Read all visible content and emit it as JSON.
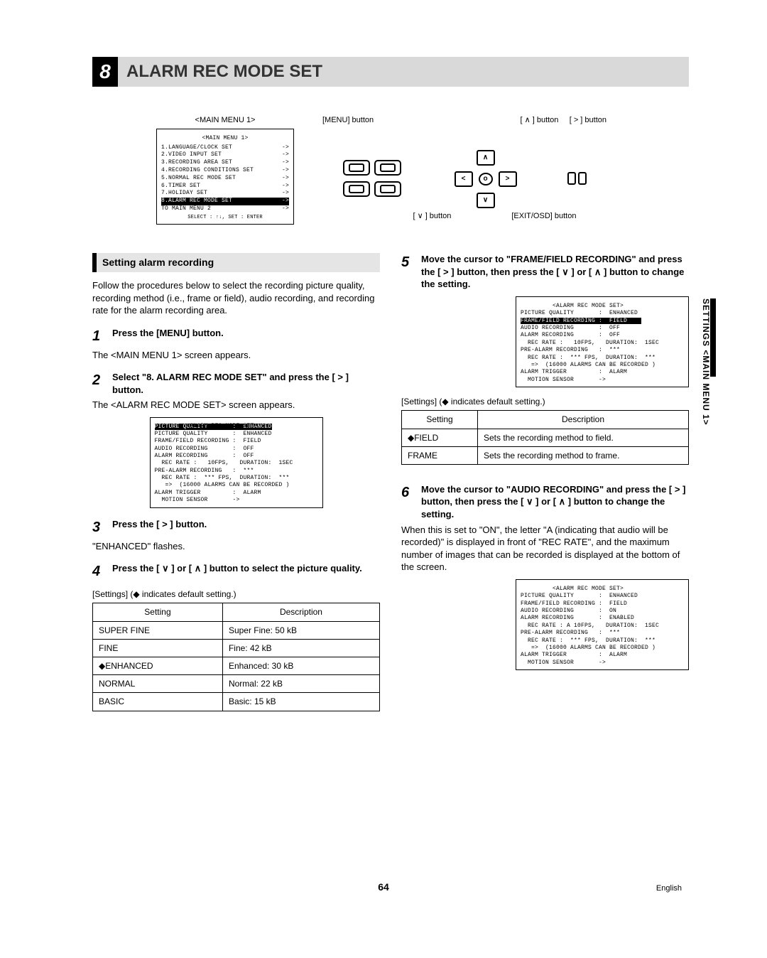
{
  "title": {
    "num": "8",
    "text": "ALARM REC MODE SET"
  },
  "main_menu": {
    "caption": "<MAIN MENU 1>",
    "header": "<MAIN MENU 1>",
    "items": [
      "1.LANGUAGE/CLOCK SET",
      "2.VIDEO INPUT SET",
      "3.RECORDING AREA SET",
      "4.RECORDING CONDITIONS SET",
      "5.NORMAL REC MODE SET",
      "6.TIMER SET",
      "7.HOLIDAY SET",
      "8.ALARM REC MODE SET",
      "TO MAIN MENU 2"
    ],
    "highlight_index": 7,
    "arrow": "->",
    "footer": "SELECT : ↑↓,   SET : ENTER"
  },
  "device_labels": {
    "menu_btn": "[MENU] button",
    "up_btn": "[ ∧ ] button",
    "right_btn": "[ > ] button",
    "down_btn": "[ ∨ ] button",
    "exit_btn": "[EXIT/OSD] button",
    "up_glyph": "∧",
    "down_glyph": "∨",
    "left_glyph": "<",
    "right_glyph": ">",
    "center_glyph": "o"
  },
  "section1_title": "Setting alarm recording",
  "intro": "Follow the procedures below to select the recording picture quality, recording method (i.e., frame or field), audio recording, and recording rate for the alarm recording area.",
  "steps": {
    "s1": {
      "n": "1",
      "h": "Press the [MENU] button.",
      "b": "The <MAIN MENU 1> screen appears."
    },
    "s2": {
      "n": "2",
      "h": "Select \"8. ALARM REC MODE SET\" and press the [ > ] button.",
      "b": "The <ALARM REC MODE SET> screen appears."
    },
    "s3": {
      "n": "3",
      "h": "Press the [ > ] button.",
      "b": "\"ENHANCED\" flashes."
    },
    "s4": {
      "n": "4",
      "h": "Press the [ ∨ ] or [ ∧ ] button to select the picture quality."
    },
    "s5": {
      "n": "5",
      "h": "Move the cursor to \"FRAME/FIELD RECORDING\" and press the [ > ] button, then press the [ ∨ ] or [ ∧ ] button to change the setting."
    },
    "s6": {
      "n": "6",
      "h": "Move the cursor to \"AUDIO RECORDING\" and press the [ > ] button, then press the [ ∨ ] or [ ∧ ] button to change the setting.",
      "b": "When this is set to \"ON\", the letter \"A (indicating that audio will be recorded)\" is displayed in front of \"REC RATE\", and the maximum number of images that can be recorded is displayed at the bottom of the screen."
    }
  },
  "settings_caption": "[Settings] (◆ indicates default setting.)",
  "table1": {
    "headers": [
      "Setting",
      "Description"
    ],
    "rows": [
      {
        "s": "SUPER FINE",
        "d": "Super Fine: 50 kB"
      },
      {
        "s": "FINE",
        "d": "Fine: 42 kB"
      },
      {
        "s": "◆ENHANCED",
        "d": "Enhanced: 30 kB"
      },
      {
        "s": "NORMAL",
        "d": "Normal: 22 kB"
      },
      {
        "s": "BASIC",
        "d": "Basic: 15 kB"
      }
    ]
  },
  "table2": {
    "headers": [
      "Setting",
      "Description"
    ],
    "rows": [
      {
        "s": "◆FIELD",
        "d": "Sets the recording method to field."
      },
      {
        "s": "FRAME",
        "d": "Sets the recording method to frame."
      }
    ]
  },
  "osd1": "         <ALARM REC MODE SET>\nPICTURE QUALITY       :  ENHANCED\nFRAME/FIELD RECORDING :  FIELD\nAUDIO RECORDING       :  OFF\nALARM RECORDING       :  OFF\n  REC RATE :   10FPS,   DURATION:  1SEC\nPRE-ALARM RECORDING   :  ***\n  REC RATE :  *** FPS,  DURATION:  ***\n   =>  (16000 ALARMS CAN BE RECORDED )\nALARM TRIGGER         :  ALARM\n  MOTION SENSOR       ->",
  "osd1_invline": "PICTURE QUALITY       :  ENHANCED",
  "osd2_top": "         <ALARM REC MODE SET>\nPICTURE QUALITY       :  ENHANCED",
  "osd2_inv": "FRAME/FIELD RECORDING :  FIELD    ",
  "osd2_bot": "AUDIO RECORDING       :  OFF\nALARM RECORDING       :  OFF\n  REC RATE :   10FPS,   DURATION:  1SEC\nPRE-ALARM RECORDING   :  ***\n  REC RATE :  *** FPS,  DURATION:  ***\n   =>  (16000 ALARMS CAN BE RECORDED )\nALARM TRIGGER         :  ALARM\n  MOTION SENSOR       ->",
  "osd3": "         <ALARM REC MODE SET>\nPICTURE QUALITY       :  ENHANCED\nFRAME/FIELD RECORDING :  FIELD\nAUDIO RECORDING       :  ON\nALARM RECORDING       :  ENABLED\n  REC RATE : A 10FPS,   DURATION:  1SEC\nPRE-ALARM RECORDING   :  ***\n  REC RATE :  *** FPS,  DURATION:  ***\n   =>  (16000 ALARMS CAN BE RECORDED )\nALARM TRIGGER         :  ALARM\n  MOTION SENSOR       ->",
  "side_tab": "SETTINGS <MAIN MENU 1>",
  "page_num": "64",
  "lang": "English"
}
